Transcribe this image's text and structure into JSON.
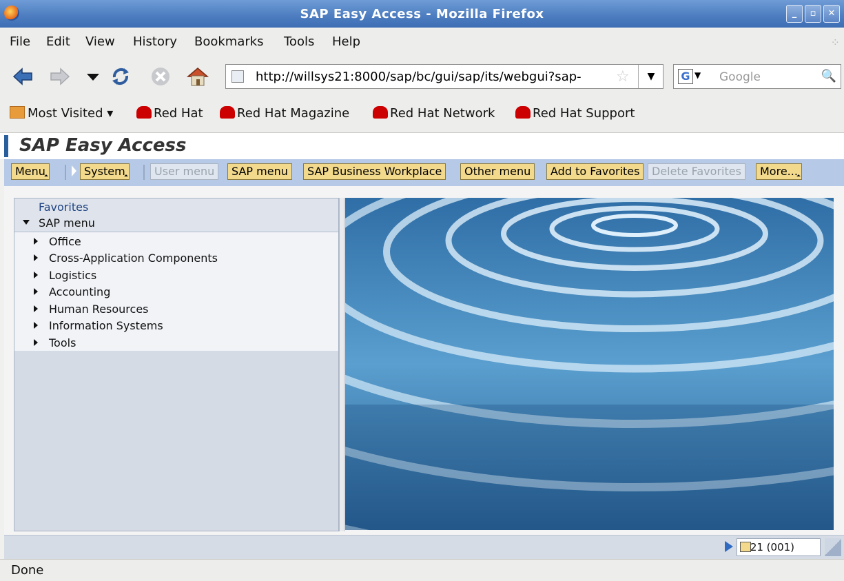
{
  "window": {
    "title": "SAP Easy Access - Mozilla Firefox"
  },
  "menubar": {
    "items": [
      {
        "label": "File"
      },
      {
        "label": "Edit"
      },
      {
        "label": "View"
      },
      {
        "label": "History"
      },
      {
        "label": "Bookmarks"
      },
      {
        "label": "Tools"
      },
      {
        "label": "Help"
      }
    ]
  },
  "navbar": {
    "url": "http://willsys21:8000/sap/bc/gui/sap/its/webgui?sap-",
    "search_placeholder": "Google"
  },
  "bookmarks": {
    "items": [
      {
        "label": "Most Visited"
      },
      {
        "label": "Red Hat"
      },
      {
        "label": "Red Hat Magazine"
      },
      {
        "label": "Red Hat Network"
      },
      {
        "label": "Red Hat Support"
      }
    ]
  },
  "sap": {
    "title": "SAP Easy Access",
    "toolbar": {
      "menu": "Menu",
      "system": "System",
      "user_menu": "User menu",
      "sap_menu": "SAP menu",
      "business_workplace": "SAP Business Workplace",
      "other_menu": "Other menu",
      "add_favorites": "Add to Favorites",
      "delete_favorites": "Delete Favorites",
      "more": "More..."
    },
    "tree": {
      "favorites": "Favorites",
      "sap_menu": "SAP menu",
      "items": [
        {
          "label": "Office"
        },
        {
          "label": "Cross-Application Components"
        },
        {
          "label": "Logistics"
        },
        {
          "label": "Accounting"
        },
        {
          "label": "Human Resources"
        },
        {
          "label": "Information Systems"
        },
        {
          "label": "Tools"
        }
      ]
    },
    "system_info": "W21 (001)"
  },
  "status": {
    "text": "Done"
  },
  "colors": {
    "toolbar_bg": "#b6c9e6",
    "button_bg": "#f2d98c",
    "titlebar": "#4f7fc1"
  }
}
